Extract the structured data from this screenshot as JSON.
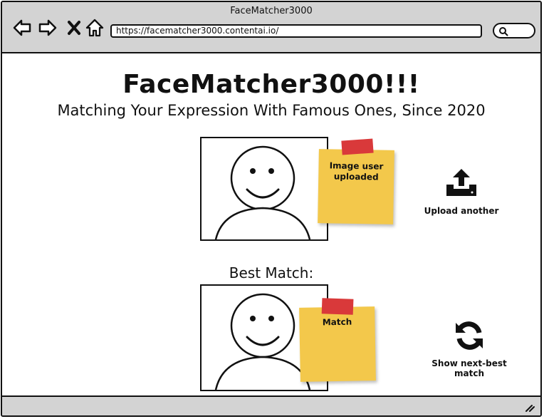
{
  "window": {
    "title": "FaceMatcher3000",
    "url": "https://facematcher3000.contentai.io/"
  },
  "header": {
    "title": "FaceMatcher3000!!!",
    "subtitle": "Matching Your Expression With Famous Ones, Since 2020"
  },
  "uploaded": {
    "note_label": "Image user uploaded",
    "action_label": "Upload another",
    "action_icon": "upload-icon"
  },
  "match": {
    "heading": "Best Match:",
    "note_label": "Match",
    "action_label": "Show next-best match",
    "action_icon": "refresh-icon"
  },
  "colors": {
    "chrome": "#d3d3d3",
    "sticky_note": "#f3c84b",
    "tape": "#d9393a"
  }
}
